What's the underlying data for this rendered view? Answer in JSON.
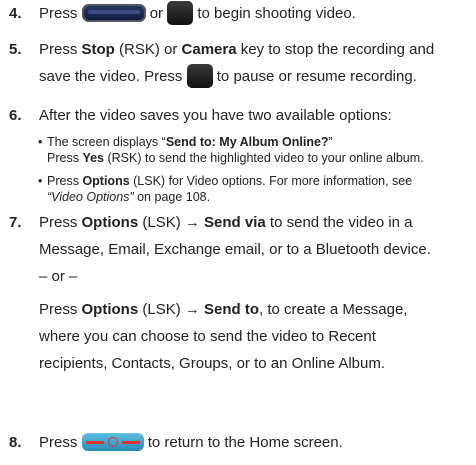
{
  "steps": [
    {
      "num": "4.",
      "t1": "Press",
      "t2": "or",
      "t3": "to begin shooting video."
    },
    {
      "num": "5.",
      "t1": "Press",
      "b1": "Stop",
      "t2": "(RSK) or",
      "b2": "Camera",
      "t3": "key to stop the recording and",
      "t4": "save the video. Press",
      "t5": "to pause or resume recording."
    },
    {
      "num": "6.",
      "t1": "After the video saves you have two available options:"
    },
    {
      "num": "7.",
      "t1": "Press",
      "b1": "Options",
      "t2": "(LSK)",
      "arrow": "→",
      "b2": "Send via",
      "t3": "to send the video in a",
      "line2": "Message, Email, Exchange email, or to a Bluetooth device.",
      "or": "– or –",
      "t4": "Press",
      "b3": "Options",
      "t5": "(LSK)",
      "b4": "Send to",
      "t6": ", to create a Message,",
      "line5": "where you can choose to send the video to Recent",
      "line6": "recipients, Contacts, Groups, or to an Online Album."
    },
    {
      "num": "8.",
      "t1": "Press",
      "t2": "to return to the Home screen."
    }
  ],
  "bullets": [
    {
      "mark": "•",
      "t1": "The screen displays “",
      "b1": "Send to: My Album Online?",
      "t2": "”",
      "line2a": "Press",
      "b2": "Yes",
      "line2b": "(RSK) to send the highlighted video to your online album."
    },
    {
      "mark": "•",
      "t1": "Press",
      "b1": "Options",
      "t2": "(LSK) for Video options. For more information, see",
      "i1": "“Video Options”",
      "t3": "on page 108."
    }
  ],
  "icons": [
    "camera-key-icon",
    "record-key-icon",
    "pause-key-icon",
    "end-key-icon"
  ]
}
